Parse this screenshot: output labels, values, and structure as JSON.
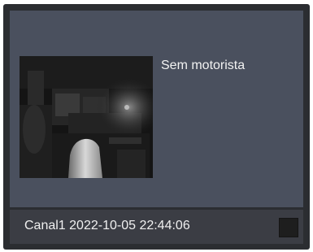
{
  "card": {
    "status_text": "Sem motorista",
    "channel": "Canal1",
    "timestamp": "2022-10-05 22:44:06",
    "footer_label": "Canal1 2022-10-05 22:44:06",
    "snapshot_icon": "camera-snapshot-image",
    "stop_icon": "stop-square-icon"
  },
  "colors": {
    "card_background": "#2b2d31",
    "body_background": "#4a505e",
    "footer_background": "#3b3d44",
    "text": "#f2f2f2"
  }
}
